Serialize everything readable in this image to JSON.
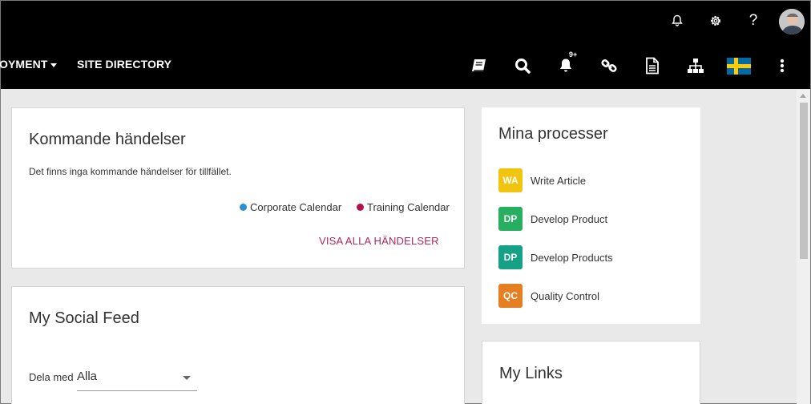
{
  "header": {
    "icons": [
      "bell-outline-icon",
      "gear-icon",
      "help-icon",
      "user-avatar"
    ],
    "help_glyph": "?"
  },
  "nav": {
    "deploy_label": "OYMENT",
    "site_directory_label": "SITE DIRECTORY",
    "notification_badge": "9+",
    "icons": [
      "book-icon",
      "search-icon",
      "bell-icon",
      "link-icon",
      "document-icon",
      "sitemap-icon",
      "sweden-flag-icon",
      "more-vertical-icon"
    ]
  },
  "events": {
    "title": "Kommande händelser",
    "empty_text": "Det finns inga kommande händelser för tillfället.",
    "legend": [
      {
        "label": "Corporate Calendar",
        "color": "#2a8fd0"
      },
      {
        "label": "Training Calendar",
        "color": "#b0124f"
      }
    ],
    "see_all": "VISA ALLA HÄNDELSER"
  },
  "feed": {
    "title": "My Social Feed",
    "share_label": "Dela med",
    "share_value": "Alla"
  },
  "processes": {
    "title": "Mina processer",
    "items": [
      {
        "initials": "WA",
        "label": "Write Article",
        "color": "#f1c40f"
      },
      {
        "initials": "DP",
        "label": "Develop Product",
        "color": "#27ae60"
      },
      {
        "initials": "DP",
        "label": "Develop Products",
        "color": "#16a085"
      },
      {
        "initials": "QC",
        "label": "Quality Control",
        "color": "#e67e22"
      }
    ]
  },
  "links": {
    "title": "My Links"
  }
}
